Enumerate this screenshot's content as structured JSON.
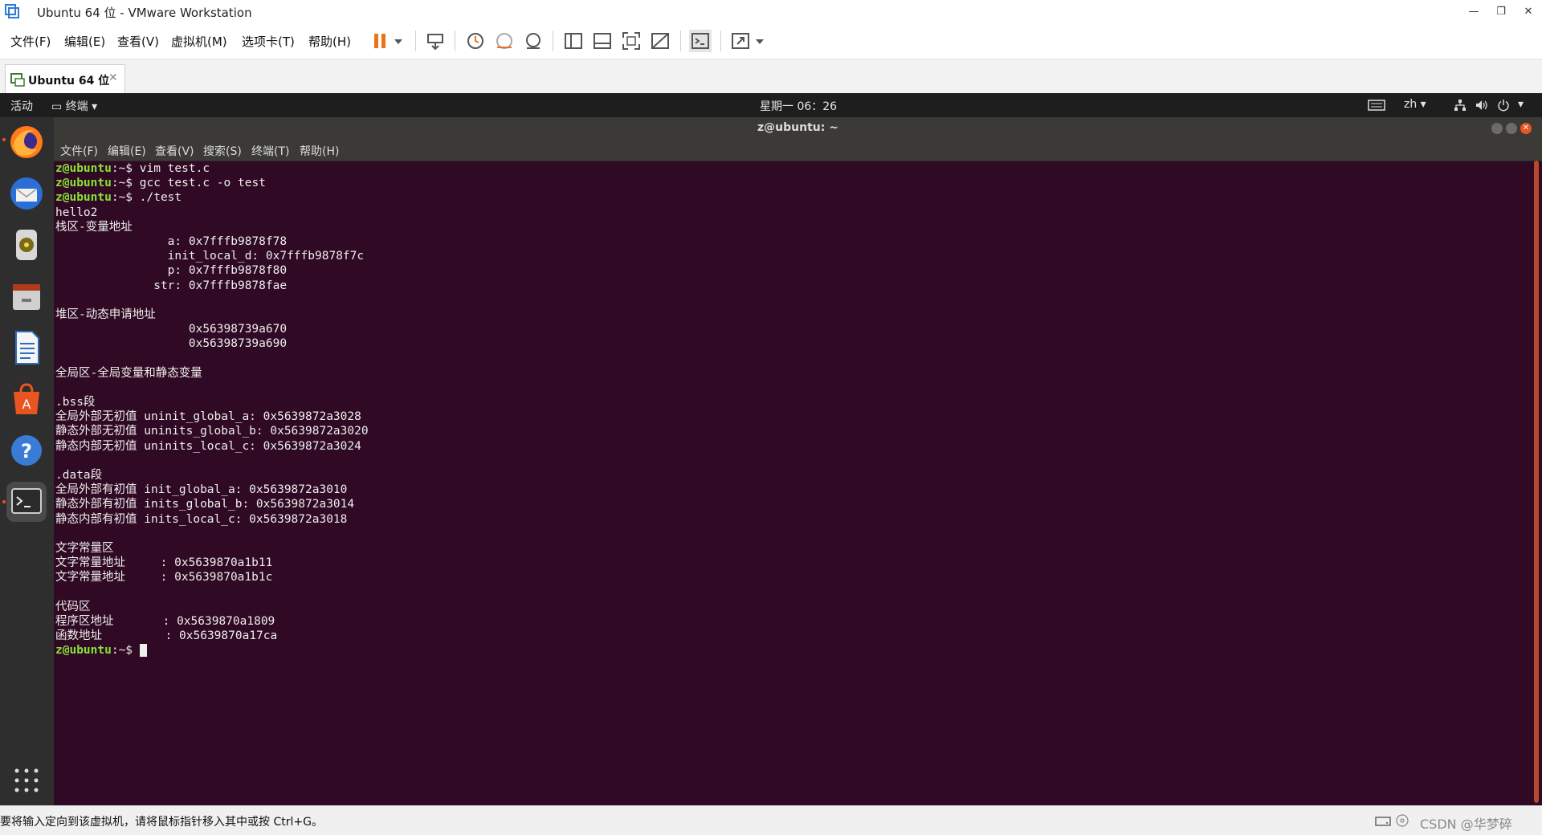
{
  "window": {
    "title": "Ubuntu 64 位 - VMware Workstation"
  },
  "menubar": [
    "文件(F)",
    "编辑(E)",
    "查看(V)",
    "虚拟机(M)",
    "选项卡(T)",
    "帮助(H)"
  ],
  "tab": {
    "label": "Ubuntu 64 位"
  },
  "guest_topbar": {
    "activities": "活动",
    "app_menu": "终端",
    "clock": "星期一 06：26",
    "input_method": "zh"
  },
  "terminal": {
    "title": "z@ubuntu: ~",
    "menu": [
      "文件(F)",
      "编辑(E)",
      "查看(V)",
      "搜索(S)",
      "终端(T)",
      "帮助(H)"
    ],
    "prompt": "z@ubuntu",
    "prompt_suffix": ":~$ ",
    "lines": [
      {
        "prompt": true,
        "text": "vim test.c"
      },
      {
        "prompt": true,
        "text": "gcc test.c -o test"
      },
      {
        "prompt": true,
        "text": "./test"
      },
      {
        "text": "hello2"
      },
      {
        "text": "栈区-变量地址"
      },
      {
        "text": "                a: 0x7fffb9878f78"
      },
      {
        "text": "                init_local_d: 0x7fffb9878f7c"
      },
      {
        "text": "                p: 0x7fffb9878f80"
      },
      {
        "text": "              str: 0x7fffb9878fae"
      },
      {
        "text": ""
      },
      {
        "text": "堆区-动态申请地址"
      },
      {
        "text": "                   0x56398739a670"
      },
      {
        "text": "                   0x56398739a690"
      },
      {
        "text": ""
      },
      {
        "text": "全局区-全局变量和静态变量"
      },
      {
        "text": ""
      },
      {
        "text": ".bss段"
      },
      {
        "text": "全局外部无初值 uninit_global_a: 0x5639872a3028"
      },
      {
        "text": "静态外部无初值 uninits_global_b: 0x5639872a3020"
      },
      {
        "text": "静态内部无初值 uninits_local_c: 0x5639872a3024"
      },
      {
        "text": ""
      },
      {
        "text": ".data段"
      },
      {
        "text": "全局外部有初值 init_global_a: 0x5639872a3010"
      },
      {
        "text": "静态外部有初值 inits_global_b: 0x5639872a3014"
      },
      {
        "text": "静态内部有初值 inits_local_c: 0x5639872a3018"
      },
      {
        "text": ""
      },
      {
        "text": "文字常量区"
      },
      {
        "text": "文字常量地址     : 0x5639870a1b11"
      },
      {
        "text": "文字常量地址     : 0x5639870a1b1c"
      },
      {
        "text": ""
      },
      {
        "text": "代码区"
      },
      {
        "text": "程序区地址       : 0x5639870a1809"
      },
      {
        "text": "函数地址         : 0x5639870a17ca"
      },
      {
        "prompt": true,
        "text": "",
        "cursor": true
      }
    ]
  },
  "statusbar": {
    "text": "要将输入定向到该虚拟机，请将鼠标指针移入其中或按 Ctrl+G。",
    "watermark": "CSDN @华梦碎"
  },
  "colors": {
    "terminal_bg": "#300a24",
    "prompt": "#8ae234",
    "accent": "#e95420"
  }
}
